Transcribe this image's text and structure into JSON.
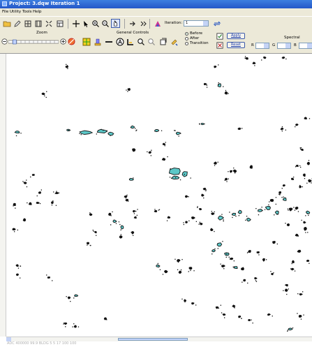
{
  "window": {
    "title": "Project: 3.dqw Iteration 1"
  },
  "menu": {
    "items": [
      "File",
      "Utility",
      "Tools",
      "Help"
    ]
  },
  "toolbar": {
    "iteration_label": "Iteration:",
    "iteration_value": "1"
  },
  "controls": {
    "zoom_label": "Zoom",
    "general_label": "General Controls",
    "spectral_label": "Spectral",
    "radio_options": [
      "Before",
      "After",
      "Transition"
    ],
    "radio_selected": "Before",
    "apply_label": "Apply",
    "reset_label": "Reset",
    "band_labels": [
      "R",
      "G",
      "B"
    ],
    "band_values": [
      "",
      "",
      ""
    ],
    "zoom_level": 0.08
  },
  "colors": {
    "feature_fill": "#5cc8c8",
    "feature_outline": "#111111",
    "toolbar_bg": "#ece9d8",
    "title_bg": "#2457c8"
  },
  "icons": {
    "toolbar1": [
      "open-folder-icon",
      "edit-icon",
      "grid-icon",
      "grid-small-icon",
      "grid-large-icon",
      "table-icon",
      "crosshair-icon",
      "arrow-pointer-icon",
      "zoom-in-icon",
      "zoom-out-icon",
      "pan-hand-icon",
      "prev-feature-icon",
      "next-feature-icon",
      "palette-icon",
      "refresh-icon"
    ],
    "toolbar2": [
      "zoom-out-circle-icon",
      "zoom-in-circle-icon",
      "no-entry-icon",
      "grid-color-icon",
      "stack-icon",
      "line-icon",
      "shape-a-icon",
      "measure-icon",
      "magnify-icon",
      "select-icon",
      "copy-icon",
      "paint-icon"
    ]
  },
  "status": {
    "text": "ADC 400000 99.9 BLDG 5 5 17 100 100"
  }
}
